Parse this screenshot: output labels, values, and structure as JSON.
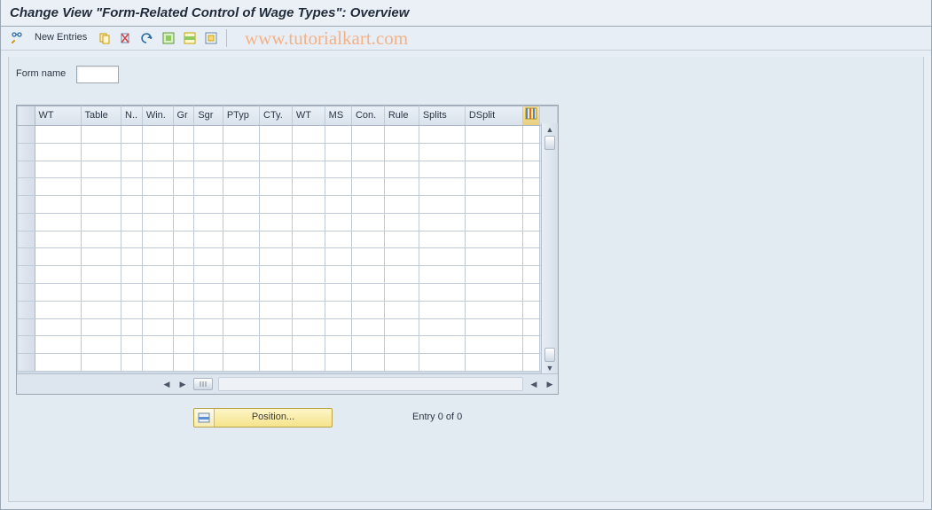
{
  "title": "Change View \"Form-Related Control of Wage Types\": Overview",
  "watermark": "www.tutorialkart.com",
  "toolbar": {
    "new_entries_label": "New Entries"
  },
  "fields": {
    "form_name_label": "Form name",
    "form_name_value": ""
  },
  "grid": {
    "columns": [
      "WT",
      "Table",
      "N..",
      "Win.",
      "Gr",
      "Sgr",
      "PTyp",
      "CTy.",
      "WT",
      "MS",
      "Con.",
      "Rule",
      "Splits",
      "DSplit"
    ],
    "rows": [
      {},
      {},
      {},
      {},
      {},
      {},
      {},
      {},
      {},
      {},
      {},
      {},
      {},
      {}
    ]
  },
  "footer": {
    "position_label": "Position...",
    "entry_label": "Entry 0 of 0"
  }
}
